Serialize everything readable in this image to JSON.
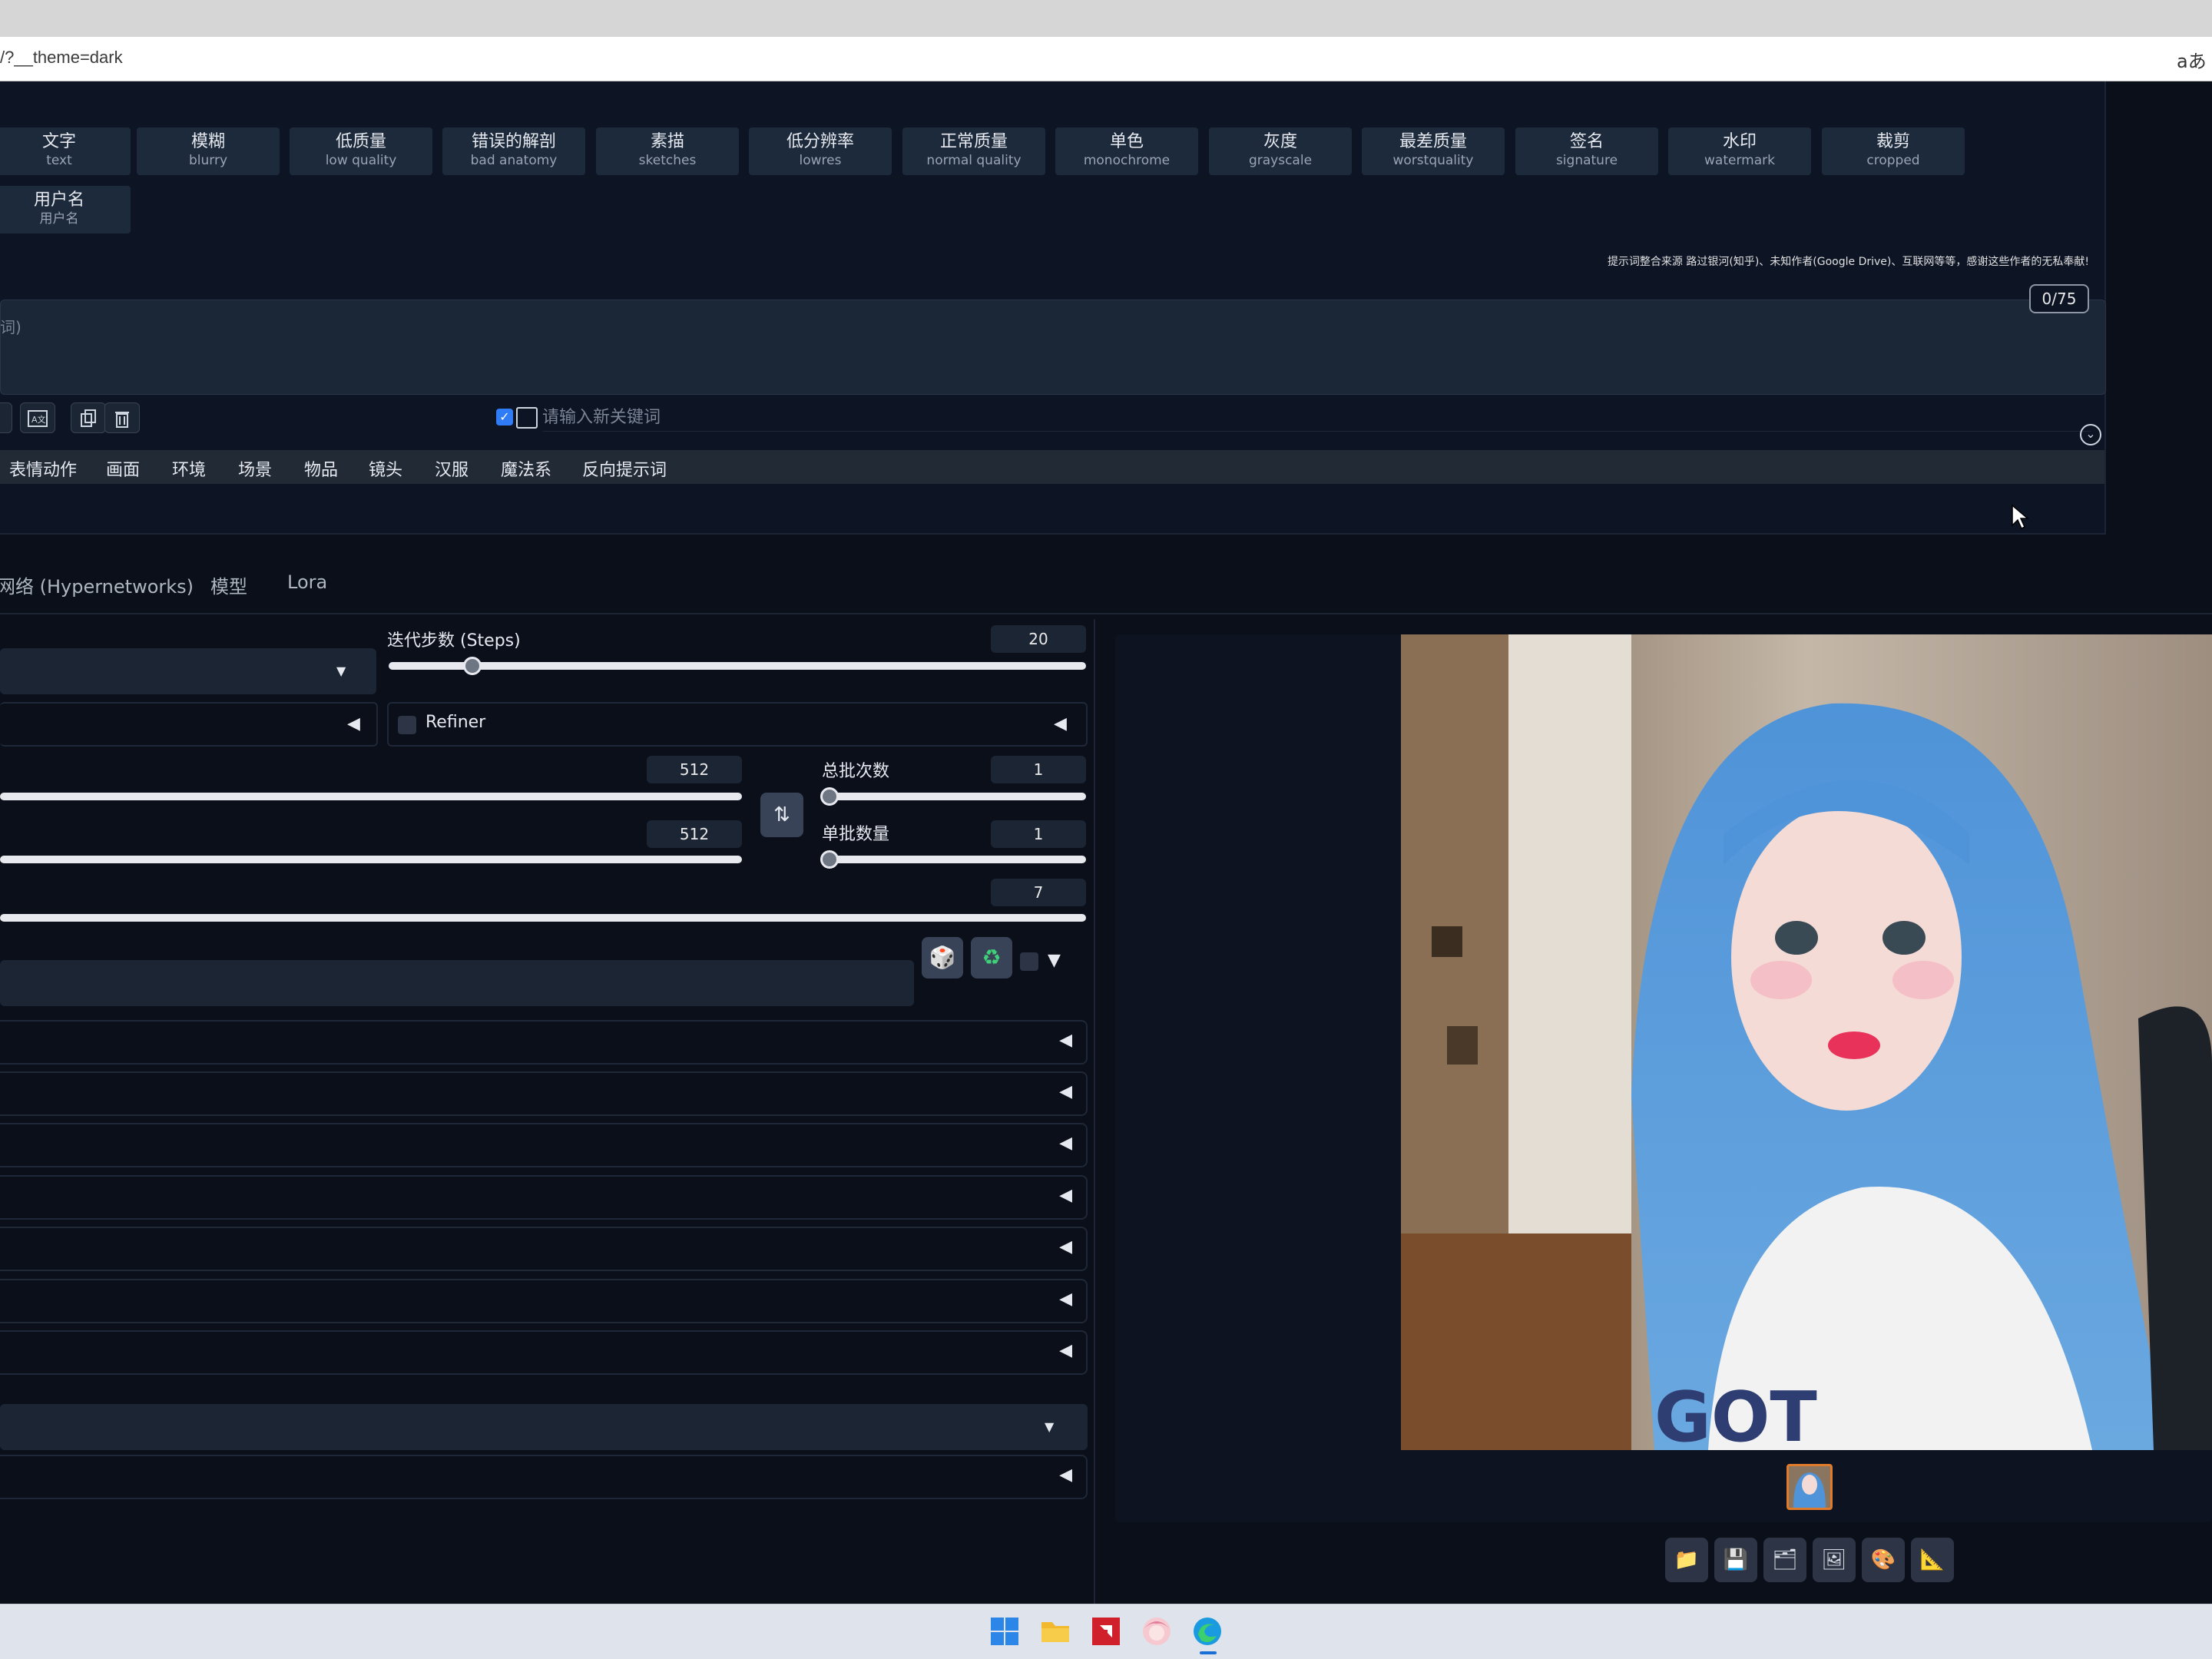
{
  "browser": {
    "url": "/?__theme=dark",
    "translate_icon": "aあ"
  },
  "tags": [
    {
      "zh": "文字",
      "en": "text"
    },
    {
      "zh": "模糊",
      "en": "blurry"
    },
    {
      "zh": "低质量",
      "en": "low quality"
    },
    {
      "zh": "错误的解剖",
      "en": "bad anatomy"
    },
    {
      "zh": "素描",
      "en": "sketches"
    },
    {
      "zh": "低分辨率",
      "en": "lowres"
    },
    {
      "zh": "正常质量",
      "en": "normal quality"
    },
    {
      "zh": "单色",
      "en": "monochrome"
    },
    {
      "zh": "灰度",
      "en": "grayscale"
    },
    {
      "zh": "最差质量",
      "en": "worstquality"
    },
    {
      "zh": "签名",
      "en": "signature"
    },
    {
      "zh": "水印",
      "en": "watermark"
    },
    {
      "zh": "裁剪",
      "en": "cropped"
    },
    {
      "zh": "用户名",
      "en": "用户名"
    }
  ],
  "credit_text": "提示词整合来源 路过银河(知乎)、未知作者(Google Drive)、互联网等等，感谢这些作者的无私奉献!",
  "prompt": {
    "hint": "词)",
    "token_count": "0/75"
  },
  "keyword_input": {
    "placeholder": "请输入新关键词"
  },
  "categories": [
    "表情动作",
    "画面",
    "环境",
    "场景",
    "物品",
    "镜头",
    "汉服",
    "魔法系",
    "反向提示词"
  ],
  "main_tabs": [
    "网络 (Hypernetworks)",
    "模型",
    "Lora"
  ],
  "steps": {
    "label": "迭代步数 (Steps)",
    "value": "20",
    "fraction": 0.12
  },
  "refiner": {
    "label": "Refiner"
  },
  "width": {
    "value": "512"
  },
  "height": {
    "value": "512"
  },
  "batch_count": {
    "label": "总批次数",
    "value": "1"
  },
  "batch_size": {
    "label": "单批数量",
    "value": "1"
  },
  "cfg": {
    "value": "7"
  },
  "icons": {
    "dice": "🎲",
    "recycle": "♻",
    "swap": "⇅",
    "folder": "📁",
    "save": "💾",
    "zip": "🗂",
    "image": "🖼",
    "palette": "🎨",
    "ruler": "📐"
  }
}
